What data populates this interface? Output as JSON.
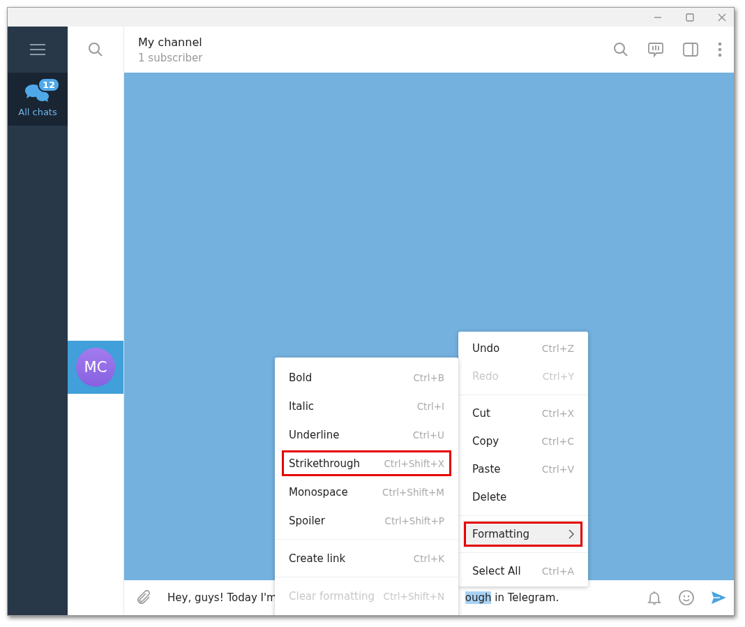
{
  "sidebar": {
    "folders": [
      {
        "label": "All chats",
        "badge": "12",
        "selected": true
      }
    ]
  },
  "chat_list": {
    "items": [
      {
        "initials": "MC",
        "selected": true
      }
    ]
  },
  "header": {
    "title": "My channel",
    "subtitle": "1 subscriber"
  },
  "composer": {
    "text_before": "Hey, guys! Today I'm",
    "selected_fragment": "ough",
    "text_after": " in Telegram."
  },
  "formatting_menu": {
    "groups": [
      [
        {
          "label": "Bold",
          "shortcut": "Ctrl+B",
          "disabled": false,
          "hovered": false,
          "highlighted": false
        },
        {
          "label": "Italic",
          "shortcut": "Ctrl+I",
          "disabled": false,
          "hovered": false,
          "highlighted": false
        },
        {
          "label": "Underline",
          "shortcut": "Ctrl+U",
          "disabled": false,
          "hovered": false,
          "highlighted": false
        },
        {
          "label": "Strikethrough",
          "shortcut": "Ctrl+Shift+X",
          "disabled": false,
          "hovered": false,
          "highlighted": true
        },
        {
          "label": "Monospace",
          "shortcut": "Ctrl+Shift+M",
          "disabled": false,
          "hovered": false,
          "highlighted": false
        },
        {
          "label": "Spoiler",
          "shortcut": "Ctrl+Shift+P",
          "disabled": false,
          "hovered": false,
          "highlighted": false
        }
      ],
      [
        {
          "label": "Create link",
          "shortcut": "Ctrl+K",
          "disabled": false,
          "hovered": false,
          "highlighted": false
        }
      ],
      [
        {
          "label": "Clear formatting",
          "shortcut": "Ctrl+Shift+N",
          "disabled": true,
          "hovered": false,
          "highlighted": false
        }
      ]
    ]
  },
  "context_menu": {
    "groups": [
      [
        {
          "label": "Undo",
          "shortcut": "Ctrl+Z",
          "disabled": false,
          "hovered": false,
          "highlighted": false,
          "submenu": false
        },
        {
          "label": "Redo",
          "shortcut": "Ctrl+Y",
          "disabled": true,
          "hovered": false,
          "highlighted": false,
          "submenu": false
        }
      ],
      [
        {
          "label": "Cut",
          "shortcut": "Ctrl+X",
          "disabled": false,
          "hovered": false,
          "highlighted": false,
          "submenu": false
        },
        {
          "label": "Copy",
          "shortcut": "Ctrl+C",
          "disabled": false,
          "hovered": false,
          "highlighted": false,
          "submenu": false
        },
        {
          "label": "Paste",
          "shortcut": "Ctrl+V",
          "disabled": false,
          "hovered": false,
          "highlighted": false,
          "submenu": false
        },
        {
          "label": "Delete",
          "disabled": false,
          "hovered": false,
          "highlighted": false,
          "submenu": false
        }
      ],
      [
        {
          "label": "Formatting",
          "disabled": false,
          "hovered": true,
          "highlighted": true,
          "submenu": true
        }
      ],
      [
        {
          "label": "Select All",
          "shortcut": "Ctrl+A",
          "disabled": false,
          "hovered": false,
          "highlighted": false,
          "submenu": false
        }
      ]
    ]
  }
}
